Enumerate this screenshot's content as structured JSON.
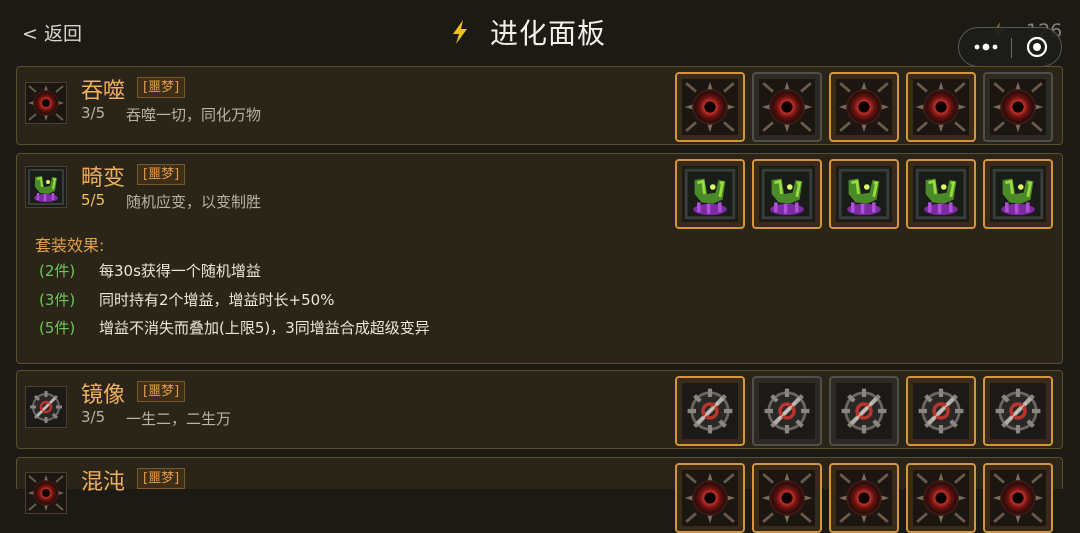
{
  "header": {
    "back_label": "< 返回",
    "title": "进化面板",
    "energy_value": "126"
  },
  "colors": {
    "background": "#1b1a15",
    "panel_bg": "#2a2518",
    "name_orange": "#f0b060",
    "tag_orange": "#e49a4c",
    "slot_active_border": "#d4963c",
    "tier_green": "#6cc85a"
  },
  "evolutions": [
    {
      "name": "吞噬",
      "tag": "[噩梦]",
      "progress": "3/5",
      "description": "吞噬一切，同化万物",
      "icon": "red-eye-icon",
      "slots_active": [
        true,
        false,
        true,
        true,
        false
      ]
    },
    {
      "name": "畸变",
      "tag": "[噩梦]",
      "progress": "5/5",
      "description": "随机应变，以变制胜",
      "icon": "toxic-creature-icon",
      "slots_active": [
        true,
        true,
        true,
        true,
        true
      ],
      "set_effects": {
        "heading": "套装效果:",
        "tiers": [
          {
            "count": "(2件)",
            "text": "每30s获得一个随机增益"
          },
          {
            "count": "(3件)",
            "text": "同时持有2个增益，增益时长+50%"
          },
          {
            "count": "(5件)",
            "text": "增益不消失而叠加(上限5)，3同增益合成超级变异"
          }
        ]
      }
    },
    {
      "name": "镜像",
      "tag": "[噩梦]",
      "progress": "3/5",
      "description": "一生二，二生万",
      "icon": "mirror-gear-icon",
      "slots_active": [
        true,
        false,
        false,
        true,
        true
      ]
    },
    {
      "name": "混沌",
      "tag": "[噩梦]",
      "progress": "",
      "description": "",
      "icon": "red-eye-icon",
      "slots_active": [
        true,
        true,
        true,
        true,
        true
      ]
    }
  ]
}
